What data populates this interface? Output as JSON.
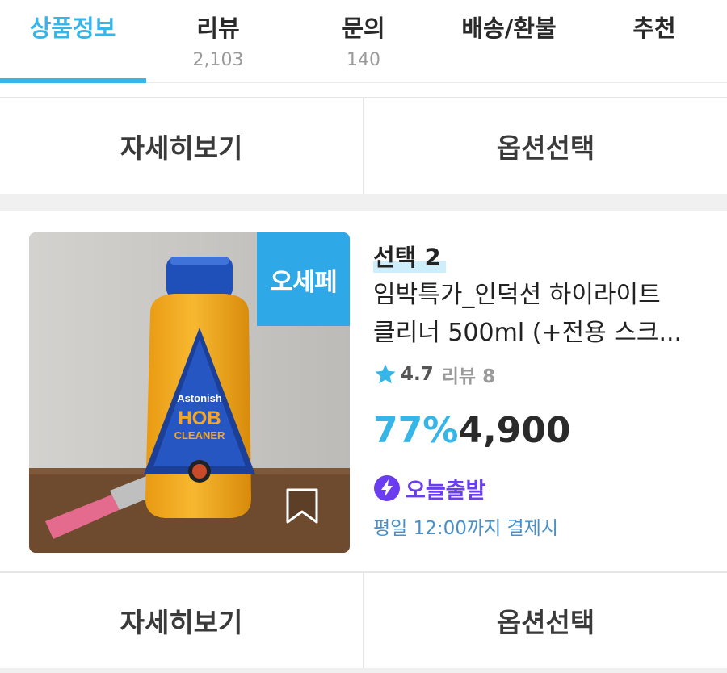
{
  "tabs": [
    {
      "label": "상품정보",
      "count": ""
    },
    {
      "label": "리뷰",
      "count": "2,103"
    },
    {
      "label": "문의",
      "count": "140"
    },
    {
      "label": "배송/환불",
      "count": ""
    },
    {
      "label": "추천",
      "count": ""
    }
  ],
  "buttons": {
    "detail": "자세히보기",
    "option": "옵션선택"
  },
  "product": {
    "badge": "오세페",
    "option_label": "선택 2",
    "title_line1": "임박특가_인덕션 하이라이트",
    "title_line2": "클리너 500ml (+전용 스크...",
    "rating": "4.7",
    "review": "리뷰 8",
    "discount": "77%",
    "price": "4,900",
    "shipping": "오늘출발",
    "shipping_note": "평일 12:00까지 결제시",
    "image_text": {
      "brand": "Astonish",
      "product_line1": "HOB",
      "product_line2": "CLEANER"
    }
  },
  "colors": {
    "accent": "#35b5e8",
    "shipping": "#6a3df0",
    "badge": "#2fa8e8"
  },
  "icons": [
    "star-icon",
    "lightning-icon",
    "bookmark-icon"
  ]
}
